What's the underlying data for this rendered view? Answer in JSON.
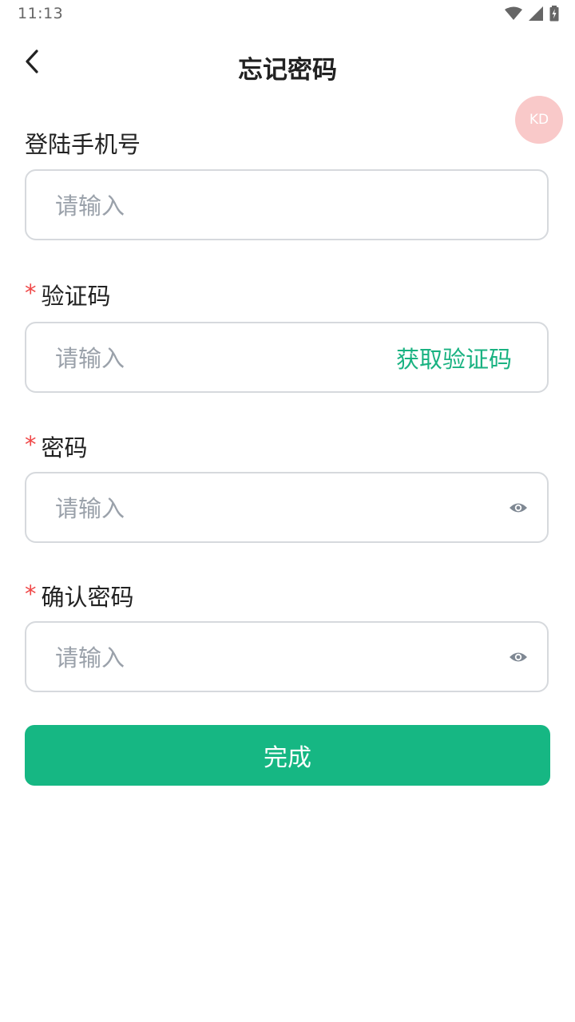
{
  "status_bar": {
    "time": "11:13"
  },
  "header": {
    "title": "忘记密码",
    "back_icon": "chevron-left-icon"
  },
  "floating_badge": {
    "label": "KD",
    "color": "#f9c9c9"
  },
  "form": {
    "phone": {
      "label": "登陆手机号",
      "required": false,
      "placeholder": "请输入",
      "value": ""
    },
    "code": {
      "label": "验证码",
      "required": true,
      "placeholder": "请输入",
      "value": "",
      "action_label": "获取验证码"
    },
    "password": {
      "label": "密码",
      "required": true,
      "placeholder": "请输入",
      "value": "",
      "toggle_icon": "eye-icon"
    },
    "confirm_password": {
      "label": "确认密码",
      "required": true,
      "placeholder": "请输入",
      "value": "",
      "toggle_icon": "eye-icon"
    },
    "required_mark": "*"
  },
  "submit": {
    "label": "完成"
  },
  "colors": {
    "accent": "#16b783",
    "link": "#19b281",
    "required": "#f04848",
    "placeholder": "#9aa1aa",
    "border": "#d6d9dd"
  }
}
